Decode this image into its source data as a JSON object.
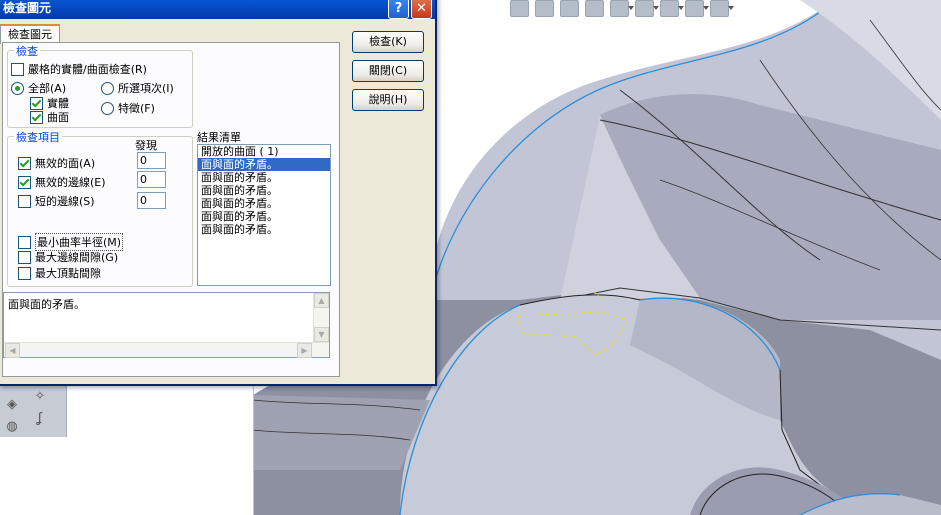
{
  "dialog": {
    "title": "檢查圖元",
    "help_glyph": "?",
    "close_glyph": "✕",
    "tab_label": "檢查圖元",
    "buttons": {
      "check": "檢查(K)",
      "close": "關閉(C)",
      "help": "說明(H)"
    },
    "check_group": {
      "title": "檢查",
      "strict": {
        "label": "嚴格的實體/曲面檢查(R)",
        "checked": false
      },
      "all": {
        "label": "全部(A)",
        "selected": true
      },
      "solid": {
        "label": "實體",
        "checked": true
      },
      "surface": {
        "label": "曲面",
        "checked": true
      },
      "selected_items": {
        "label": "所選項次(I)",
        "selected": false
      },
      "feature": {
        "label": "特徵(F)",
        "selected": false
      }
    },
    "items_group": {
      "title": "檢查項目",
      "found_header": "發現",
      "invalid_faces": {
        "label": "無效的面(A)",
        "checked": true,
        "found": "0"
      },
      "invalid_edges": {
        "label": "無效的邊線(E)",
        "checked": true,
        "found": "0"
      },
      "short_edges": {
        "label": "短的邊線(S)",
        "checked": false,
        "found": "0"
      },
      "min_radius": {
        "label": "最小曲率半徑(M)",
        "checked": false
      },
      "max_edge_gap": {
        "label": "最大邊線間隙(G)",
        "checked": false
      },
      "max_vertex_gap": {
        "label": "最大頂點間隙",
        "checked": false
      }
    },
    "results": {
      "title": "結果清單",
      "items": [
        "開放的曲面 ( 1)",
        "面與面的矛盾。",
        "面與面的矛盾。",
        "面與面的矛盾。",
        "面與面的矛盾。",
        "面與面的矛盾。",
        "面與面的矛盾。"
      ],
      "selected_index": 1
    },
    "message": "面與面的矛盾。"
  },
  "toolbar_icons": [
    "zoom-to-fit-icon",
    "zoom-area-icon",
    "zoom-selection-icon",
    "section-view-icon",
    "view-orientation-icon",
    "display-style-icon",
    "hide-show-icon",
    "edit-appearance-icon",
    "apply-scene-icon"
  ],
  "colors": {
    "title_bar": "#0546c0",
    "selection": "#316ac5",
    "model_surface": "#bdc2d2",
    "model_edge_highlight": "#2a8fd6",
    "highlight_dashed": "#e8d832"
  }
}
